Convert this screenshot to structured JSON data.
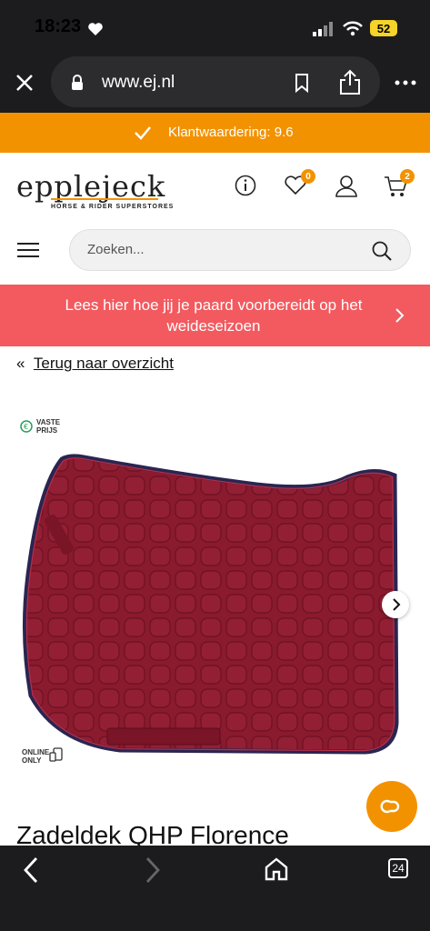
{
  "status": {
    "time": "18:23",
    "battery": "52"
  },
  "browser": {
    "url": "www.ej.nl",
    "tab_count": "24"
  },
  "rating_bar": {
    "text": "Klantwaardering: 9.6"
  },
  "header": {
    "logo": "epplejeck",
    "logo_sub": "HORSE & RIDER SUPERSTORES",
    "wishlist_count": "0",
    "cart_count": "2"
  },
  "search": {
    "placeholder": "Zoeken..."
  },
  "promo": {
    "text": "Lees hier hoe jij je paard voorbereidt op het weideseizoen"
  },
  "nav": {
    "back_prefix": "«",
    "back_label": "Terug naar overzicht"
  },
  "product": {
    "badge_fixed_line1": "VASTE",
    "badge_fixed_line2": "PRIJS",
    "badge_online_line1": "ONLINE",
    "badge_online_line2": "ONLY",
    "title": "Zadeldek QHP Florence"
  },
  "colors": {
    "orange": "#f39200",
    "promo_red": "#f25a5f",
    "pad_red": "#8a1a2e",
    "pad_trim": "#2a2550"
  }
}
